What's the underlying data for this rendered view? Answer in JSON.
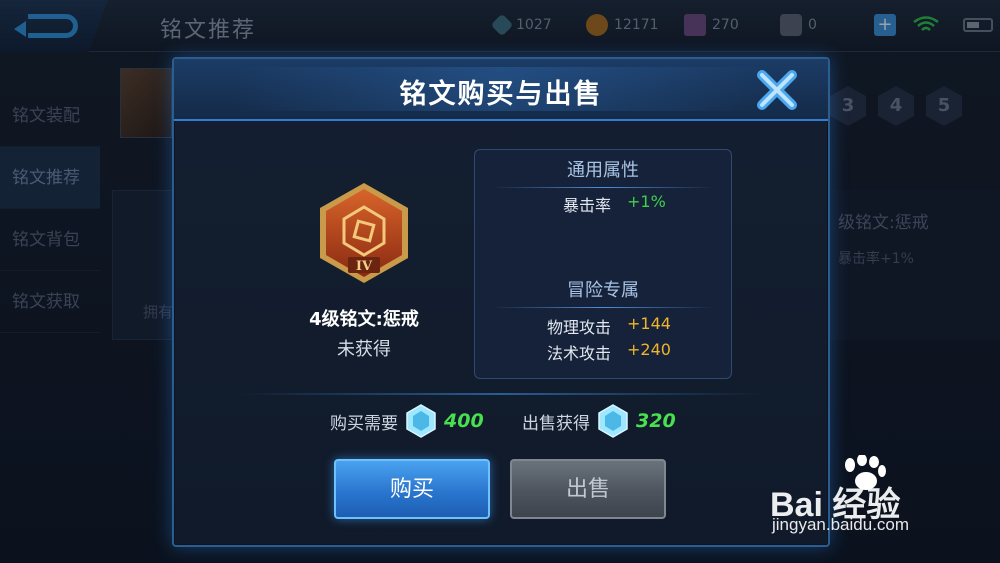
{
  "topbar": {
    "title": "铭文推荐",
    "currencies": [
      {
        "name": "crystal-icon",
        "value": "1027"
      },
      {
        "name": "gold-coin-icon",
        "value": "12171"
      },
      {
        "name": "diamond-icon",
        "value": "270"
      },
      {
        "name": "ticket-icon",
        "value": "0"
      }
    ],
    "plus_label": "+"
  },
  "sidebar": {
    "items": [
      {
        "label": "铭文装配",
        "active": false
      },
      {
        "label": "铭文推荐",
        "active": true
      },
      {
        "label": "铭文背包",
        "active": false
      },
      {
        "label": "铭文获取",
        "active": false
      }
    ]
  },
  "background": {
    "card_label": "拥有",
    "right_title": "级铭文:惩戒",
    "right_attr": "暴击率+1%",
    "level_tabs": [
      "3",
      "4",
      "5"
    ]
  },
  "modal": {
    "title": "铭文购买与出售",
    "rune": {
      "badge": "IV",
      "name": "4级铭文:惩戒",
      "status": "未获得"
    },
    "general": {
      "heading": "通用属性",
      "attrs": [
        {
          "key": "暴击率",
          "value": "+1%"
        }
      ]
    },
    "adventure": {
      "heading": "冒险专属",
      "attrs": [
        {
          "key": "物理攻击",
          "value": "+144"
        },
        {
          "key": "法术攻击",
          "value": "+240"
        }
      ]
    },
    "buy_price_label": "购买需要",
    "buy_price": "400",
    "sell_price_label": "出售获得",
    "sell_price": "320",
    "buy_button": "购买",
    "sell_button": "出售"
  },
  "watermark": {
    "brand": "Bai  经验",
    "url": "jingyan.baidu.com"
  },
  "colors": {
    "accent_blue": "#2f7fd0",
    "positive_green": "#3fd04a",
    "stat_gold": "#f0b52a",
    "price_green": "#48e050"
  }
}
